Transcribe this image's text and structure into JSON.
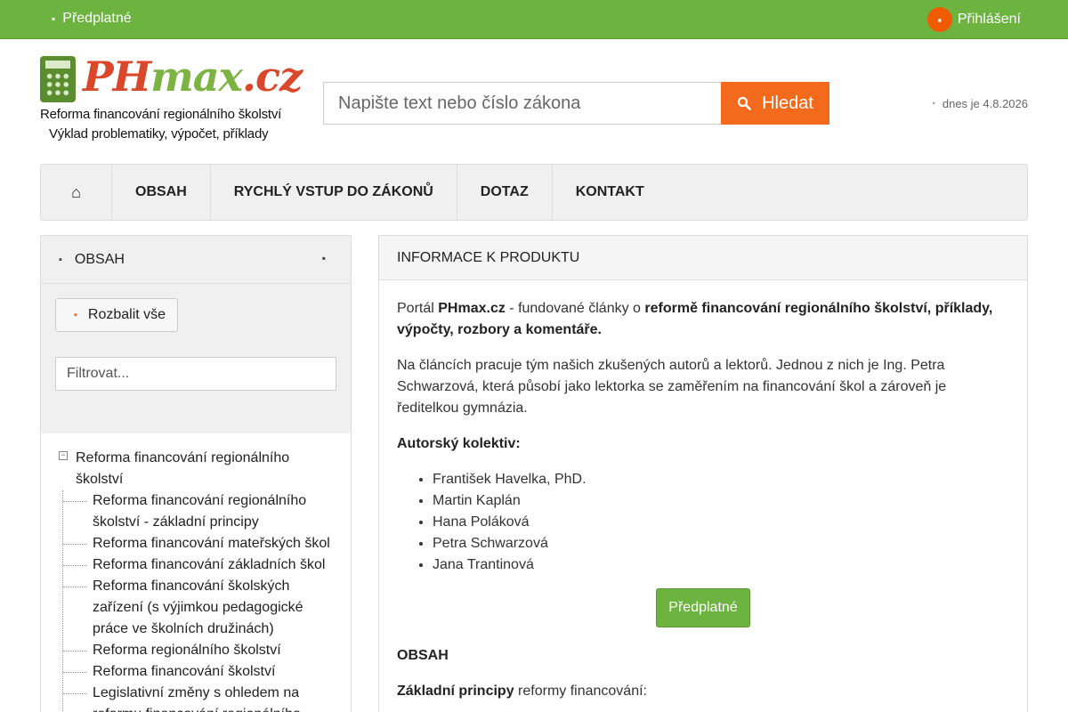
{
  "topbar": {
    "subscribe_label": "Předplatné",
    "subscribe_icon": "cart-icon",
    "login_label": "Přihlášení",
    "login_icon": "user-icon"
  },
  "brand": {
    "logo_ph": "PH",
    "logo_max": "max",
    "logo_tld": ".cz",
    "tagline1": "Reforma financování regionálního školství",
    "tagline2": "Výklad problematiky, výpočet, příklady"
  },
  "search": {
    "placeholder": "Napište text nebo číslo zákona",
    "button_label": "Hledat"
  },
  "date_text": "dnes je 4.8.2026",
  "nav": {
    "home_icon": "⌂",
    "items": [
      "OBSAH",
      "RYCHLÝ VSTUP DO ZÁKONŮ",
      "DOTAZ",
      "KONTAKT"
    ]
  },
  "sidebar": {
    "title": "OBSAH",
    "expand_label": "Rozbalit vše",
    "filter_placeholder": "Filtrovat...",
    "tree": {
      "root": "Reforma financování regionálního školství",
      "children": [
        "Reforma financování regionálního školství - základní principy",
        "Reforma financování mateřských škol",
        "Reforma financování základních škol",
        "Reforma financování školských zařízení (s výjimkou pedagogické práce ve školních družinách)",
        "Reforma regionálního školství",
        "Reforma financování školství",
        "Legislativní změny s ohledem na reformu financování regionálního školství"
      ]
    }
  },
  "main": {
    "header": "INFORMACE K PRODUKTU",
    "intro_pre": "Portál ",
    "intro_brand": "PHmax.cz",
    "intro_mid": " - fundované články o ",
    "intro_bold": "reformě financování regionálního školství, příklady, výpočty, rozbory a komentáře.",
    "team_text": "Na článcích pracuje tým našich zkušených autorů a lektorů. Jednou z nich je Ing. Petra Schwarzová, která působí jako lektorka se zaměřením na financování škol a zároveň je ředitelkou gymnázia.",
    "authors_heading": "Autorský kolektiv:",
    "authors": [
      "František Havelka, PhD.",
      "Martin Kaplán",
      "Hana Poláková",
      "Petra Schwarzová",
      "Jana Trantinová"
    ],
    "cta_label": "Předplatné",
    "contents_heading": "OBSAH",
    "principles_bold": "Základní principy",
    "principles_rest": " reformy financování:"
  },
  "colors": {
    "topbar": "#6cb33f",
    "accent_orange": "#f36a1c",
    "logo_red": "#d9482b",
    "logo_green": "#7cb342"
  }
}
